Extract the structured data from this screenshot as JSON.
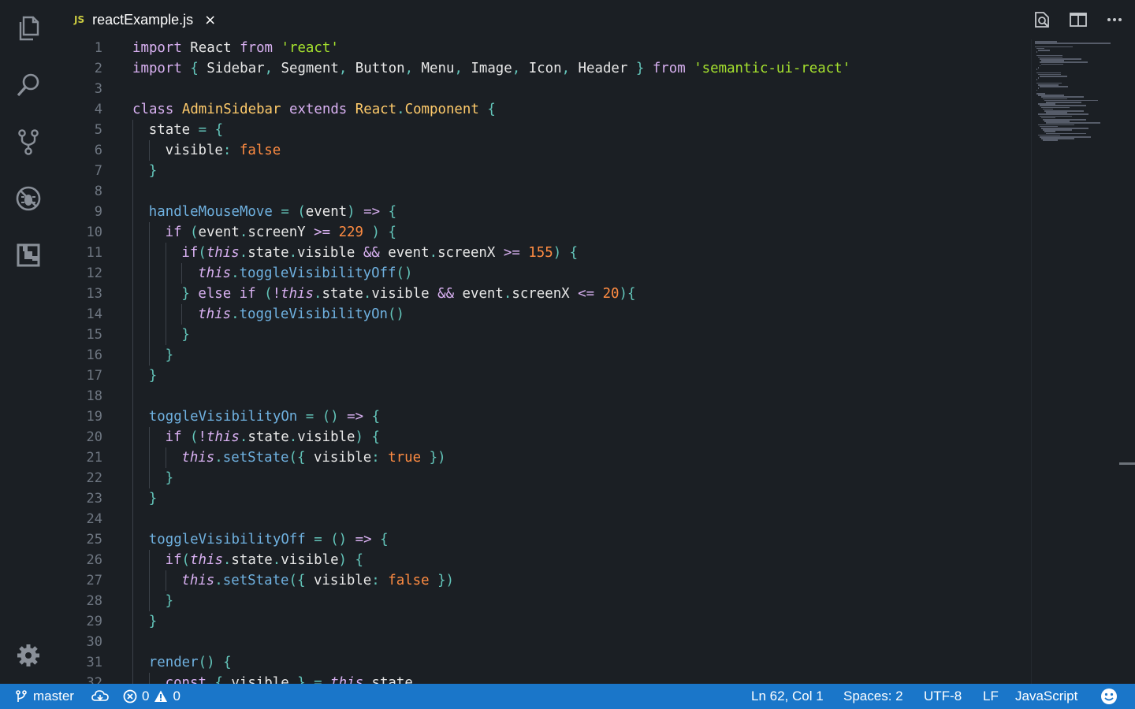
{
  "activity_bar": {
    "items": [
      {
        "name": "explorer",
        "icon": "files-icon"
      },
      {
        "name": "search",
        "icon": "search-icon"
      },
      {
        "name": "source-control",
        "icon": "git-branch-icon"
      },
      {
        "name": "debug",
        "icon": "debug-icon"
      },
      {
        "name": "extensions",
        "icon": "extensions-icon"
      }
    ],
    "settings_icon": "gear-icon"
  },
  "tab": {
    "lang_badge": "JS",
    "filename": "reactExample.js",
    "close_glyph": "×"
  },
  "title_actions": [
    "open-preview-icon",
    "split-editor-icon",
    "more-actions-icon"
  ],
  "editor": {
    "lines": [
      {
        "n": "1",
        "indent": 0,
        "tokens": [
          [
            "kw",
            "import"
          ],
          [
            "var",
            " React "
          ],
          [
            "kw",
            "from"
          ],
          [
            "var",
            " "
          ],
          [
            "str",
            "'react'"
          ]
        ]
      },
      {
        "n": "2",
        "indent": 0,
        "tokens": [
          [
            "kw",
            "import"
          ],
          [
            "var",
            " "
          ],
          [
            "pun",
            "{"
          ],
          [
            "var",
            " Sidebar"
          ],
          [
            "pun",
            ","
          ],
          [
            "var",
            " Segment"
          ],
          [
            "pun",
            ","
          ],
          [
            "var",
            " Button"
          ],
          [
            "pun",
            ","
          ],
          [
            "var",
            " Menu"
          ],
          [
            "pun",
            ","
          ],
          [
            "var",
            " Image"
          ],
          [
            "pun",
            ","
          ],
          [
            "var",
            " Icon"
          ],
          [
            "pun",
            ","
          ],
          [
            "var",
            " Header "
          ],
          [
            "pun",
            "}"
          ],
          [
            "var",
            " "
          ],
          [
            "kw",
            "from"
          ],
          [
            "var",
            " "
          ],
          [
            "str",
            "'semantic-ui-react'"
          ]
        ]
      },
      {
        "n": "3",
        "indent": 0,
        "tokens": []
      },
      {
        "n": "4",
        "indent": 0,
        "tokens": [
          [
            "kw",
            "class"
          ],
          [
            "var",
            " "
          ],
          [
            "cls",
            "AdminSidebar"
          ],
          [
            "var",
            " "
          ],
          [
            "kw",
            "extends"
          ],
          [
            "var",
            " "
          ],
          [
            "cls",
            "React"
          ],
          [
            "pun",
            "."
          ],
          [
            "cls",
            "Component"
          ],
          [
            "var",
            " "
          ],
          [
            "pun",
            "{"
          ]
        ]
      },
      {
        "n": "5",
        "indent": 1,
        "tokens": [
          [
            "var",
            "state "
          ],
          [
            "pun",
            "="
          ],
          [
            "var",
            " "
          ],
          [
            "pun",
            "{"
          ]
        ]
      },
      {
        "n": "6",
        "indent": 2,
        "tokens": [
          [
            "var",
            "visible"
          ],
          [
            "pun",
            ":"
          ],
          [
            "var",
            " "
          ],
          [
            "bool",
            "false"
          ]
        ]
      },
      {
        "n": "7",
        "indent": 1,
        "tokens": [
          [
            "pun",
            "}"
          ]
        ]
      },
      {
        "n": "8",
        "indent": 0,
        "tokens": []
      },
      {
        "n": "9",
        "indent": 1,
        "tokens": [
          [
            "fn",
            "handleMouseMove"
          ],
          [
            "var",
            " "
          ],
          [
            "pun",
            "="
          ],
          [
            "var",
            " "
          ],
          [
            "pun",
            "("
          ],
          [
            "var",
            "event"
          ],
          [
            "pun",
            ")"
          ],
          [
            "var",
            " "
          ],
          [
            "kw",
            "=>"
          ],
          [
            "var",
            " "
          ],
          [
            "pun",
            "{"
          ]
        ]
      },
      {
        "n": "10",
        "indent": 2,
        "tokens": [
          [
            "kw",
            "if"
          ],
          [
            "var",
            " "
          ],
          [
            "pun",
            "("
          ],
          [
            "var",
            "event"
          ],
          [
            "pun",
            "."
          ],
          [
            "var",
            "screenY "
          ],
          [
            "kw",
            ">="
          ],
          [
            "var",
            " "
          ],
          [
            "num",
            "229"
          ],
          [
            "var",
            " "
          ],
          [
            "pun",
            ")"
          ],
          [
            "var",
            " "
          ],
          [
            "pun",
            "{"
          ]
        ]
      },
      {
        "n": "11",
        "indent": 3,
        "tokens": [
          [
            "kw",
            "if"
          ],
          [
            "pun",
            "("
          ],
          [
            "this",
            "this"
          ],
          [
            "pun",
            "."
          ],
          [
            "var",
            "state"
          ],
          [
            "pun",
            "."
          ],
          [
            "var",
            "visible "
          ],
          [
            "kw",
            "&&"
          ],
          [
            "var",
            " event"
          ],
          [
            "pun",
            "."
          ],
          [
            "var",
            "screenX "
          ],
          [
            "kw",
            ">="
          ],
          [
            "var",
            " "
          ],
          [
            "num",
            "155"
          ],
          [
            "pun",
            ")"
          ],
          [
            "var",
            " "
          ],
          [
            "pun",
            "{"
          ]
        ]
      },
      {
        "n": "12",
        "indent": 4,
        "tokens": [
          [
            "this",
            "this"
          ],
          [
            "pun",
            "."
          ],
          [
            "fn",
            "toggleVisibilityOff"
          ],
          [
            "pun",
            "()"
          ]
        ]
      },
      {
        "n": "13",
        "indent": 3,
        "tokens": [
          [
            "pun",
            "}"
          ],
          [
            "var",
            " "
          ],
          [
            "kw",
            "else if"
          ],
          [
            "var",
            " "
          ],
          [
            "pun",
            "("
          ],
          [
            "kw",
            "!"
          ],
          [
            "this",
            "this"
          ],
          [
            "pun",
            "."
          ],
          [
            "var",
            "state"
          ],
          [
            "pun",
            "."
          ],
          [
            "var",
            "visible "
          ],
          [
            "kw",
            "&&"
          ],
          [
            "var",
            " event"
          ],
          [
            "pun",
            "."
          ],
          [
            "var",
            "screenX "
          ],
          [
            "kw",
            "<="
          ],
          [
            "var",
            " "
          ],
          [
            "num",
            "20"
          ],
          [
            "pun",
            ")"
          ],
          [
            "pun",
            "{"
          ]
        ]
      },
      {
        "n": "14",
        "indent": 4,
        "tokens": [
          [
            "this",
            "this"
          ],
          [
            "pun",
            "."
          ],
          [
            "fn",
            "toggleVisibilityOn"
          ],
          [
            "pun",
            "()"
          ]
        ]
      },
      {
        "n": "15",
        "indent": 3,
        "tokens": [
          [
            "pun",
            "}"
          ]
        ]
      },
      {
        "n": "16",
        "indent": 2,
        "tokens": [
          [
            "pun",
            "}"
          ]
        ]
      },
      {
        "n": "17",
        "indent": 1,
        "tokens": [
          [
            "pun",
            "}"
          ]
        ]
      },
      {
        "n": "18",
        "indent": 0,
        "tokens": []
      },
      {
        "n": "19",
        "indent": 1,
        "tokens": [
          [
            "fn",
            "toggleVisibilityOn"
          ],
          [
            "var",
            " "
          ],
          [
            "pun",
            "="
          ],
          [
            "var",
            " "
          ],
          [
            "pun",
            "()"
          ],
          [
            "var",
            " "
          ],
          [
            "kw",
            "=>"
          ],
          [
            "var",
            " "
          ],
          [
            "pun",
            "{"
          ]
        ]
      },
      {
        "n": "20",
        "indent": 2,
        "tokens": [
          [
            "kw",
            "if"
          ],
          [
            "var",
            " "
          ],
          [
            "pun",
            "("
          ],
          [
            "kw",
            "!"
          ],
          [
            "this",
            "this"
          ],
          [
            "pun",
            "."
          ],
          [
            "var",
            "state"
          ],
          [
            "pun",
            "."
          ],
          [
            "var",
            "visible"
          ],
          [
            "pun",
            ")"
          ],
          [
            "var",
            " "
          ],
          [
            "pun",
            "{"
          ]
        ]
      },
      {
        "n": "21",
        "indent": 3,
        "tokens": [
          [
            "this",
            "this"
          ],
          [
            "pun",
            "."
          ],
          [
            "fn",
            "setState"
          ],
          [
            "pun",
            "({"
          ],
          [
            "var",
            " visible"
          ],
          [
            "pun",
            ":"
          ],
          [
            "var",
            " "
          ],
          [
            "bool",
            "true"
          ],
          [
            "var",
            " "
          ],
          [
            "pun",
            "})"
          ]
        ]
      },
      {
        "n": "22",
        "indent": 2,
        "tokens": [
          [
            "pun",
            "}"
          ]
        ]
      },
      {
        "n": "23",
        "indent": 1,
        "tokens": [
          [
            "pun",
            "}"
          ]
        ]
      },
      {
        "n": "24",
        "indent": 0,
        "tokens": []
      },
      {
        "n": "25",
        "indent": 1,
        "tokens": [
          [
            "fn",
            "toggleVisibilityOff"
          ],
          [
            "var",
            " "
          ],
          [
            "pun",
            "="
          ],
          [
            "var",
            " "
          ],
          [
            "pun",
            "()"
          ],
          [
            "var",
            " "
          ],
          [
            "kw",
            "=>"
          ],
          [
            "var",
            " "
          ],
          [
            "pun",
            "{"
          ]
        ]
      },
      {
        "n": "26",
        "indent": 2,
        "tokens": [
          [
            "kw",
            "if"
          ],
          [
            "pun",
            "("
          ],
          [
            "this",
            "this"
          ],
          [
            "pun",
            "."
          ],
          [
            "var",
            "state"
          ],
          [
            "pun",
            "."
          ],
          [
            "var",
            "visible"
          ],
          [
            "pun",
            ")"
          ],
          [
            "var",
            " "
          ],
          [
            "pun",
            "{"
          ]
        ]
      },
      {
        "n": "27",
        "indent": 3,
        "tokens": [
          [
            "this",
            "this"
          ],
          [
            "pun",
            "."
          ],
          [
            "fn",
            "setState"
          ],
          [
            "pun",
            "({"
          ],
          [
            "var",
            " visible"
          ],
          [
            "pun",
            ":"
          ],
          [
            "var",
            " "
          ],
          [
            "bool",
            "false"
          ],
          [
            "var",
            " "
          ],
          [
            "pun",
            "})"
          ]
        ]
      },
      {
        "n": "28",
        "indent": 2,
        "tokens": [
          [
            "pun",
            "}"
          ]
        ]
      },
      {
        "n": "29",
        "indent": 1,
        "tokens": [
          [
            "pun",
            "}"
          ]
        ]
      },
      {
        "n": "30",
        "indent": 0,
        "tokens": []
      },
      {
        "n": "31",
        "indent": 1,
        "tokens": [
          [
            "fn",
            "render"
          ],
          [
            "pun",
            "()"
          ],
          [
            "var",
            " "
          ],
          [
            "pun",
            "{"
          ]
        ]
      },
      {
        "n": "32",
        "indent": 2,
        "tokens": [
          [
            "kw",
            "const"
          ],
          [
            "var",
            " "
          ],
          [
            "pun",
            "{"
          ],
          [
            "var",
            " visible "
          ],
          [
            "pun",
            "}"
          ],
          [
            "var",
            " "
          ],
          [
            "pun",
            "="
          ],
          [
            "var",
            " "
          ],
          [
            "this",
            "this"
          ],
          [
            "pun",
            "."
          ],
          [
            "var",
            "state"
          ]
        ]
      }
    ]
  },
  "status_bar": {
    "branch": "master",
    "errors": "0",
    "warnings": "0",
    "cursor": "Ln 62, Col 1",
    "spaces": "Spaces: 2",
    "encoding": "UTF-8",
    "eol": "LF",
    "language": "JavaScript",
    "feedback_icon": "smiley-icon"
  },
  "colors": {
    "background": "#1b1f24",
    "status_bar": "#1a76c9",
    "keyword": "#d9b1f2",
    "string": "#a6e22e",
    "class": "#ffcb6b",
    "function": "#6fb1e0",
    "number": "#ff8c42",
    "punctuation": "#63c5ba"
  }
}
